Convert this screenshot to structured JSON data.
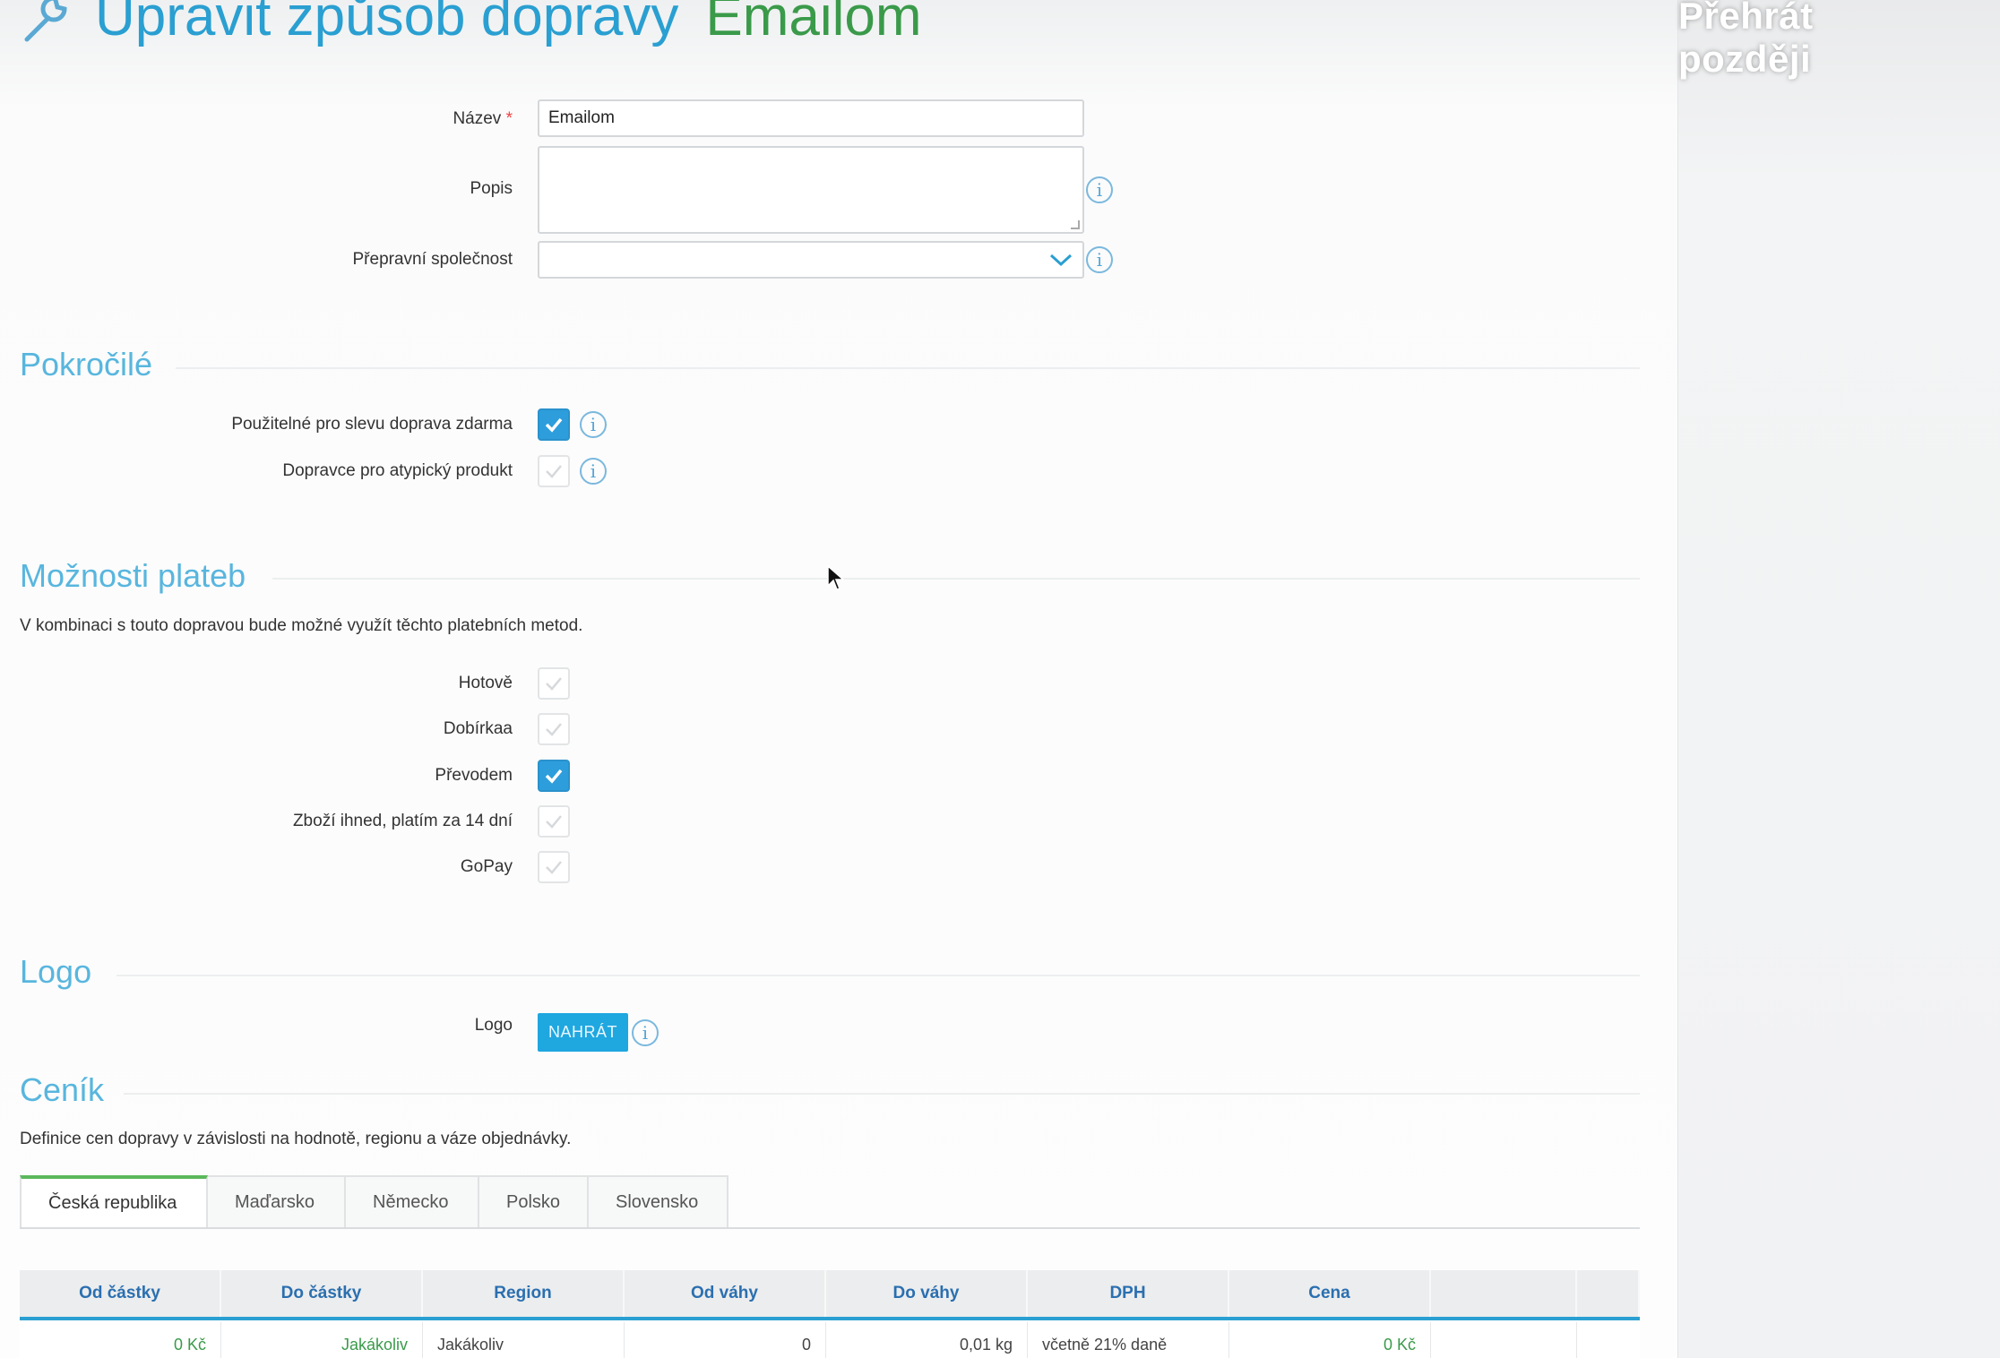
{
  "overlay": {
    "play_later": "Přehrát později"
  },
  "header": {
    "title": "Upravit způsob dopravy",
    "name": "Emailom"
  },
  "form": {
    "nazev_label": "Název",
    "required_mark": "*",
    "nazev_value": "Emailom",
    "popis_label": "Popis",
    "popis_value": "",
    "prepravni_label": "Přepravní společnost",
    "prepravni_value": ""
  },
  "advanced": {
    "title": "Pokročilé",
    "options": [
      {
        "label": "Použitelné pro slevu doprava zdarma",
        "checked": true
      },
      {
        "label": "Dopravce pro atypický produkt",
        "checked": false
      }
    ]
  },
  "payments": {
    "title": "Možnosti plateb",
    "description": "V kombinaci s touto dopravou bude možné využít těchto platebních metod.",
    "methods": [
      {
        "label": "Hotově",
        "checked": false
      },
      {
        "label": "Dobírkaa",
        "checked": false
      },
      {
        "label": "Převodem",
        "checked": true
      },
      {
        "label": "Zboží ihned, platím za 14 dní",
        "checked": false
      },
      {
        "label": "GoPay",
        "checked": false
      }
    ]
  },
  "logo": {
    "title": "Logo",
    "label": "Logo",
    "upload_button": "NAHRÁT"
  },
  "pricelist": {
    "title": "Ceník",
    "description": "Definice cen dopravy v závislosti na hodnotě, regionu a váze objednávky.",
    "tabs": [
      "Česká republika",
      "Maďarsko",
      "Německo",
      "Polsko",
      "Slovensko"
    ],
    "active_tab": "Česká republika",
    "columns": [
      "Od částky",
      "Do částky",
      "Region",
      "Od váhy",
      "Do váhy",
      "DPH",
      "Cena"
    ],
    "rows": [
      [
        "0 Kč",
        "Jakákoliv",
        "Jakákoliv",
        "0",
        "0,01 kg",
        "včetně 21% daně",
        "0 Kč"
      ]
    ]
  },
  "colors": {
    "accent": "#2a9fd1",
    "green": "#3a9a4a",
    "section": "#58b6de"
  },
  "icons": {
    "title": "wrench-icon",
    "info": "info-icon",
    "dropdown": "chevron-down-icon",
    "check": "check-icon"
  }
}
